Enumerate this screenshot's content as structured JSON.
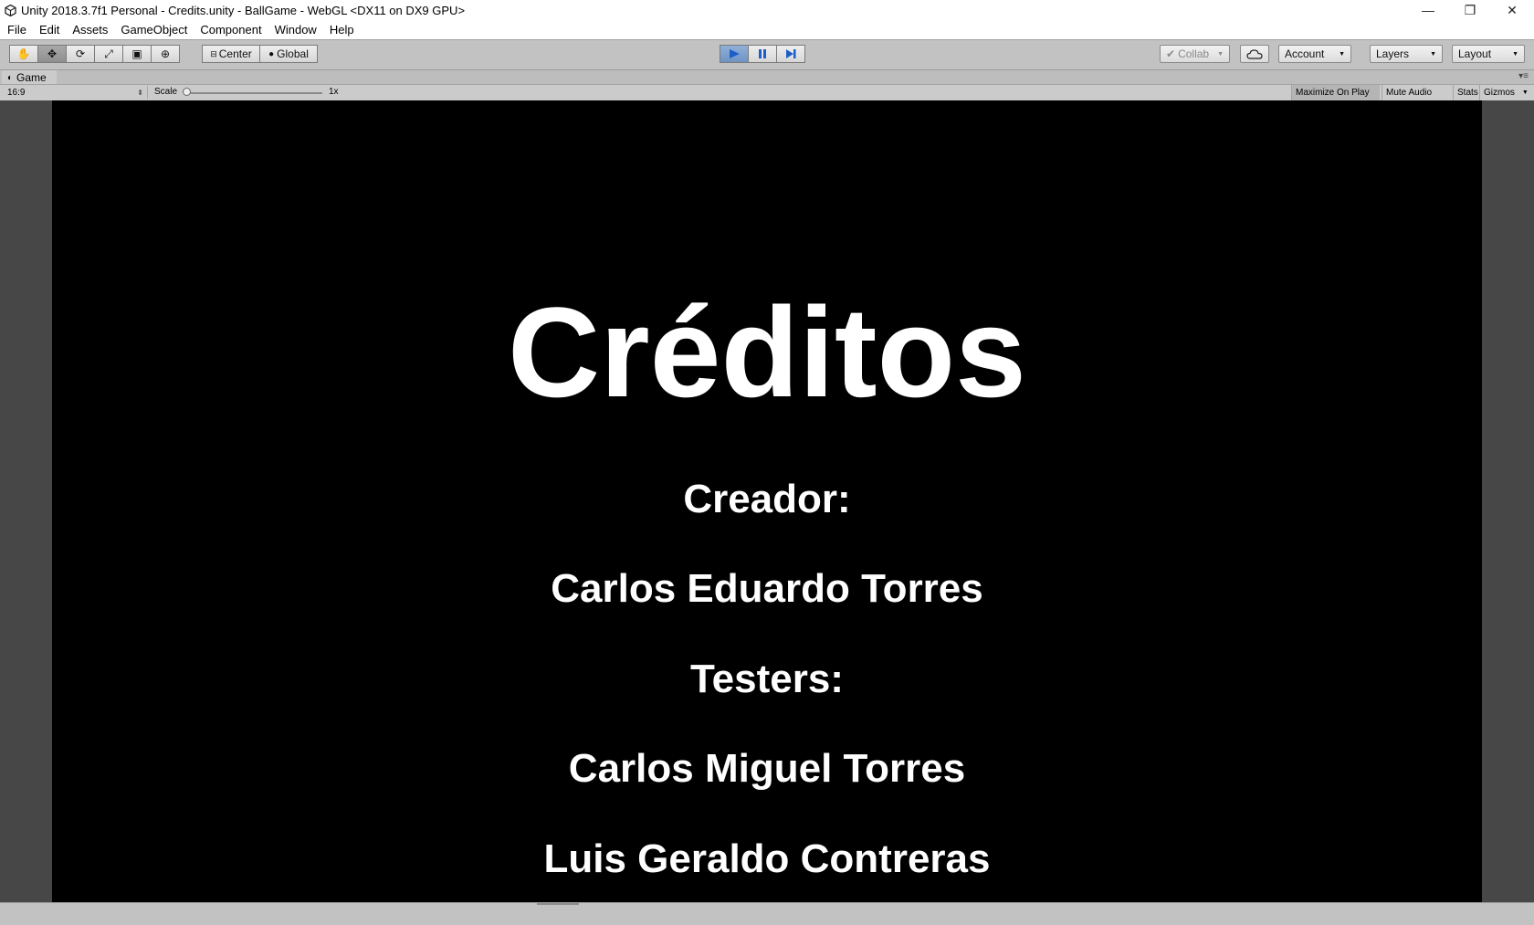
{
  "window": {
    "title": "Unity 2018.3.7f1 Personal - Credits.unity - BallGame - WebGL <DX11 on DX9 GPU>",
    "minimize_glyph": "—",
    "restore_glyph": "❐",
    "close_glyph": "✕"
  },
  "menu": [
    "File",
    "Edit",
    "Assets",
    "GameObject",
    "Component",
    "Window",
    "Help"
  ],
  "toolbar": {
    "transform_tools": [
      {
        "icon": "hand-tool-icon",
        "glyph": "✋"
      },
      {
        "icon": "move-tool-icon",
        "glyph": "✥"
      },
      {
        "icon": "rotate-tool-icon",
        "glyph": "⟳"
      },
      {
        "icon": "scale-tool-icon",
        "glyph": "⤢"
      },
      {
        "icon": "rect-tool-icon",
        "glyph": "▣"
      },
      {
        "icon": "transform-tool-icon",
        "glyph": "⊕"
      }
    ],
    "active_tool": "move",
    "pivot_label": "Center",
    "space_label": "Global",
    "collab_label": "Collab",
    "account_label": "Account",
    "layers_label": "Layers",
    "layout_label": "Layout",
    "play_state": "playing"
  },
  "game_tab": {
    "label": "Game"
  },
  "game_view": {
    "aspect": "16:9",
    "scale_label": "Scale",
    "scale_value": "1x",
    "maximize_label": "Maximize On Play",
    "mute_label": "Mute Audio",
    "stats_label": "Stats",
    "gizmos_label": "Gizmos"
  },
  "credits": {
    "title": "Créditos",
    "creator_heading": "Creador:",
    "creator_name": "Carlos Eduardo Torres",
    "testers_heading": "Testers:",
    "tester_1": "Carlos Miguel Torres",
    "tester_2": "Luis Geraldo Contreras"
  }
}
